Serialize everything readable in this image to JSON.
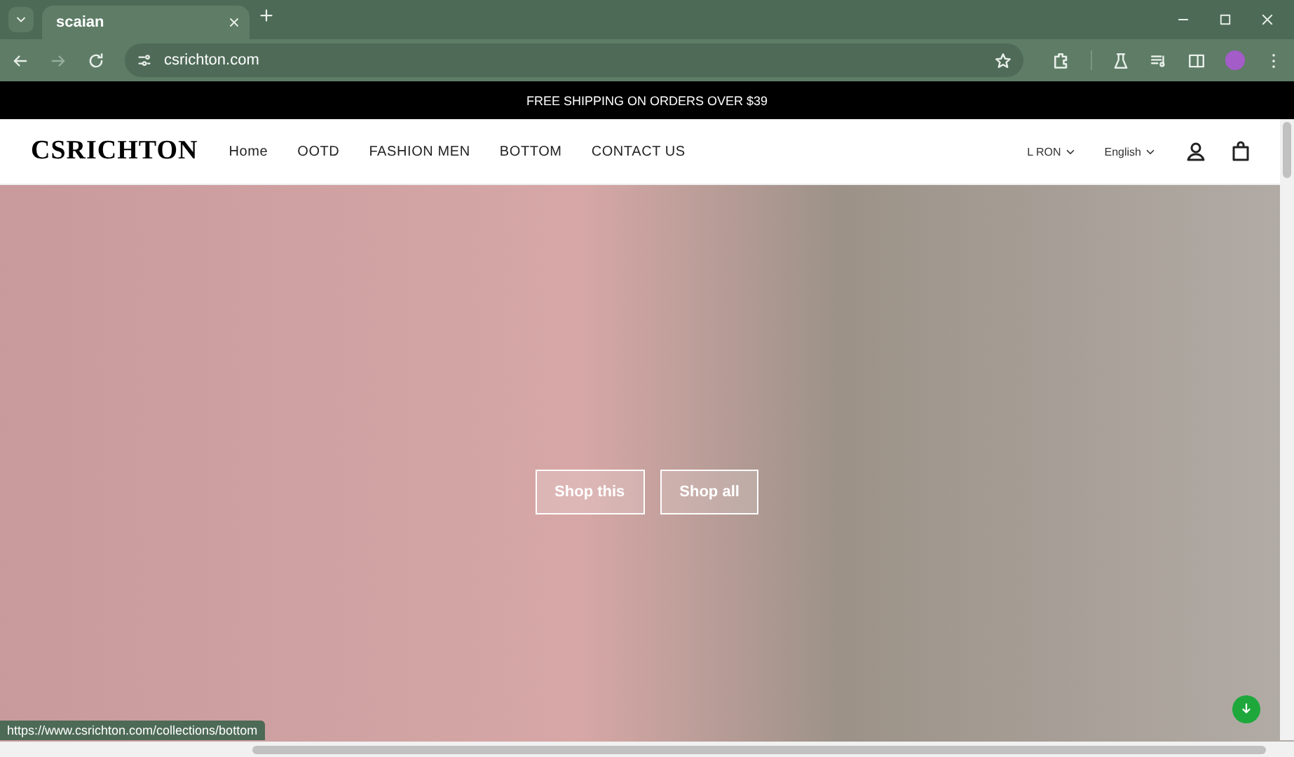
{
  "browser": {
    "tab_title": "scaian",
    "url": "csrichton.com",
    "status_url": "https://www.csrichton.com/collections/bottom"
  },
  "announcement": "FREE SHIPPING ON ORDERS OVER $39",
  "header": {
    "logo": "CSRICHTON",
    "nav": [
      {
        "label": "Home",
        "selected": false
      },
      {
        "label": "OOTD",
        "selected": false
      },
      {
        "label": "FASHION MEN",
        "selected": false
      },
      {
        "label": "BOTTOM",
        "selected": false
      },
      {
        "label": "CONTACT US",
        "selected": false
      }
    ],
    "currency": "L RON",
    "language": "English"
  },
  "hero": {
    "buttons": [
      "Shop this",
      "Shop all"
    ]
  }
}
